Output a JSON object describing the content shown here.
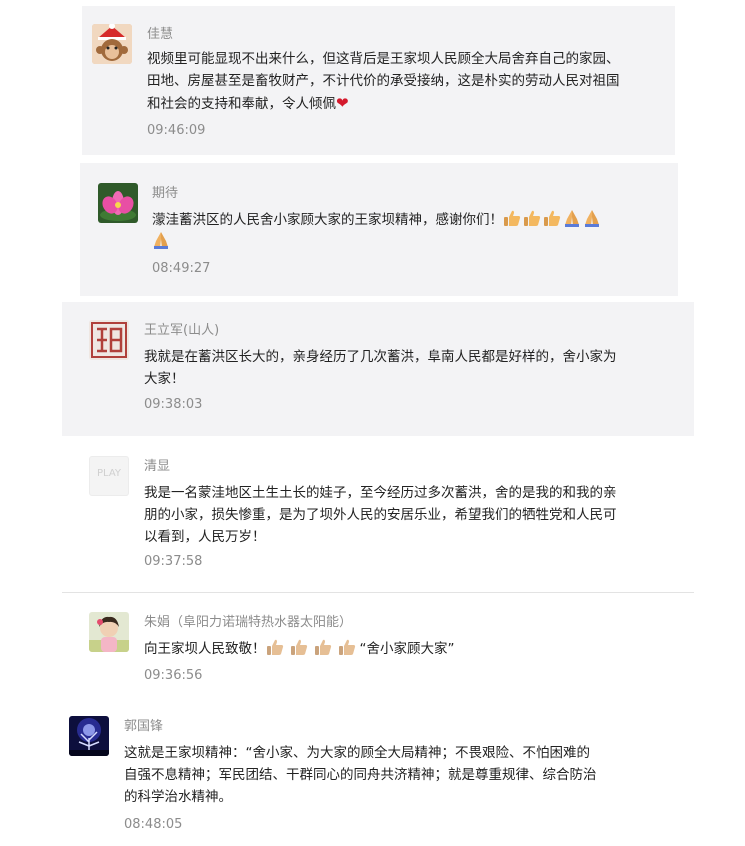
{
  "comments": [
    {
      "author": "佳慧",
      "text_parts": [
        "视频里可能显现不出来什么，但这背后是王家坝人民顾全大局舍弃自己的家园、田地、房屋甚至是畜牧财产，不计代价的承受接纳，这是朴实的劳动人民对祖国和社会的支持和奉献，令人倾佩"
      ],
      "emoji_icon": "heart-icon",
      "time": "09:46:09"
    },
    {
      "author": "期待",
      "text": "濛洼蓄洪区的人民舍小家顾大家的王家坝精神，感谢你们！",
      "emoji_icons": [
        "thumbs-up-icon",
        "thumbs-up-icon",
        "thumbs-up-icon",
        "folded-hands-icon",
        "folded-hands-icon",
        "folded-hands-icon"
      ],
      "time": "08:49:27"
    },
    {
      "author": "王立军(山人)",
      "text": "我就是在蓄洪区长大的，亲身经历了几次蓄洪，阜南人民都是好样的，舍小家为大家！",
      "time": "09:38:03"
    },
    {
      "author": "清显",
      "avatar_text": "PLAY",
      "text": "我是一名蒙洼地区土生土长的娃子，至今经历过多次蓄洪，舍的是我的和我的亲朋的小家，损失惨重，是为了坝外人民的安居乐业，希望我们的牺牲党和人民可以看到，人民万岁！",
      "time": "09:37:58"
    },
    {
      "author": "朱娟（阜阳力诺瑞特热水器太阳能）",
      "text_before": "向王家坝人民致敬！",
      "emoji_icons": [
        "thumbs-up-icon",
        "thumbs-up-icon",
        "thumbs-up-icon",
        "thumbs-up-icon"
      ],
      "text_after": "“舍小家顾大家”",
      "time": "09:36:56"
    },
    {
      "author": "郭国锋",
      "text": "这就是王家坝精神：“舍小家、为大家的顾全大局精神；不畏艰险、不怕困难的自强不息精神；军民团结、干群同心的同舟共济精神；就是尊重规律、综合防治的科学治水精神。",
      "time": "08:48:05"
    }
  ]
}
